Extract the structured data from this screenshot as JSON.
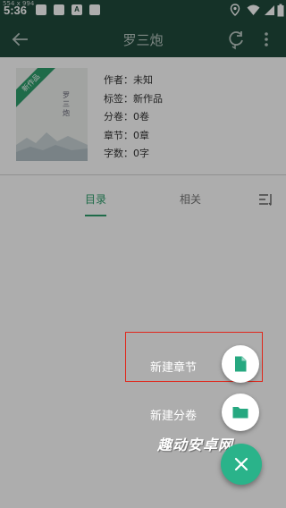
{
  "status_bar": {
    "dims": "554 x 994",
    "time": "5:36",
    "notif_letter": "A"
  },
  "toolbar": {
    "title": "罗三炮"
  },
  "book": {
    "ribbon": "新作品",
    "cover_title": "罗三炮",
    "meta": {
      "author": "作者：未知",
      "tag": "标签：新作品",
      "volumes": "分卷：0卷",
      "chapters": "章节：0章",
      "words": "字数：0字"
    }
  },
  "tabs": {
    "items": [
      {
        "label": "目录",
        "active": true
      },
      {
        "label": "相关",
        "active": false
      }
    ]
  },
  "fab_menu": {
    "new_chapter": "新建章节",
    "new_volume": "新建分卷"
  },
  "watermark": "趣动安卓网",
  "colors": {
    "primary_dark": "#1f4a3c",
    "accent": "#2ab38a",
    "highlight": "#e0271b"
  },
  "icons": [
    "back-arrow-icon",
    "refresh-icon",
    "more-vert-icon",
    "sort-icon",
    "document-icon",
    "folder-icon",
    "close-icon"
  ]
}
